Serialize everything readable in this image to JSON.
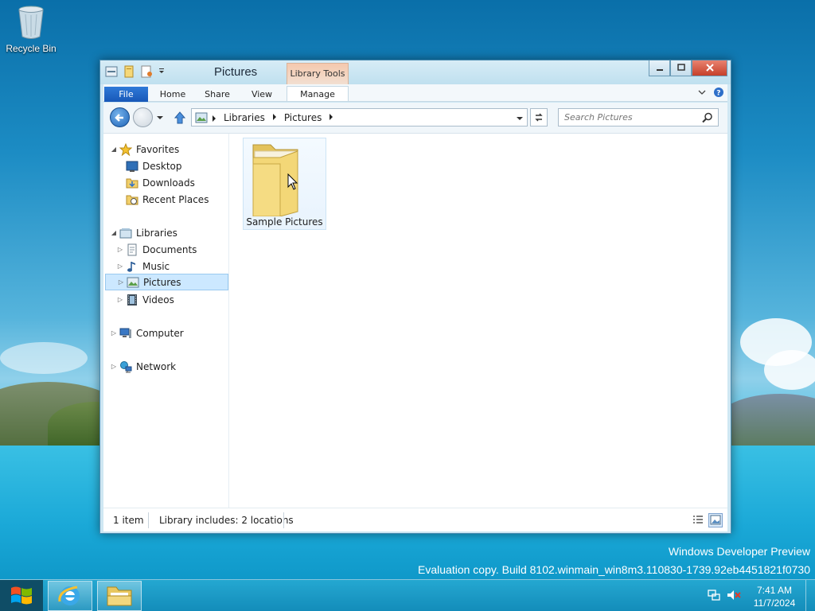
{
  "desktop": {
    "recycle_bin_label": "Recycle Bin",
    "watermark_line1": "Windows Developer Preview",
    "watermark_line2": "Evaluation copy. Build 8102.winmain_win8m3.110830-1739.92eb4451821f0730"
  },
  "window": {
    "title": "Pictures",
    "context_tab_group": "Library Tools",
    "ribbon_tabs": [
      "File",
      "Home",
      "Share",
      "View",
      "Manage"
    ],
    "address": {
      "breadcrumbs": [
        "Libraries",
        "Pictures"
      ]
    },
    "search": {
      "placeholder": "Search Pictures"
    },
    "nav_pane": {
      "favorites_label": "Favorites",
      "favorites": [
        "Desktop",
        "Downloads",
        "Recent Places"
      ],
      "libraries_label": "Libraries",
      "libraries": [
        "Documents",
        "Music",
        "Pictures",
        "Videos"
      ],
      "selected": "Pictures",
      "computer_label": "Computer",
      "network_label": "Network"
    },
    "items": [
      {
        "name": "Sample Pictures",
        "type": "folder"
      }
    ],
    "status": {
      "item_count": "1 item",
      "library_info": "Library includes: 2 locations"
    }
  },
  "taskbar": {
    "pinned": [
      "internet-explorer",
      "file-explorer"
    ],
    "time": "7:41 AM",
    "date": "11/7/2024"
  },
  "colors": {
    "ribbon_file_tab": "#1f63c0",
    "context_tab": "#f5c9ae",
    "selection": "#cce8ff",
    "close_button": "#c6402a"
  }
}
